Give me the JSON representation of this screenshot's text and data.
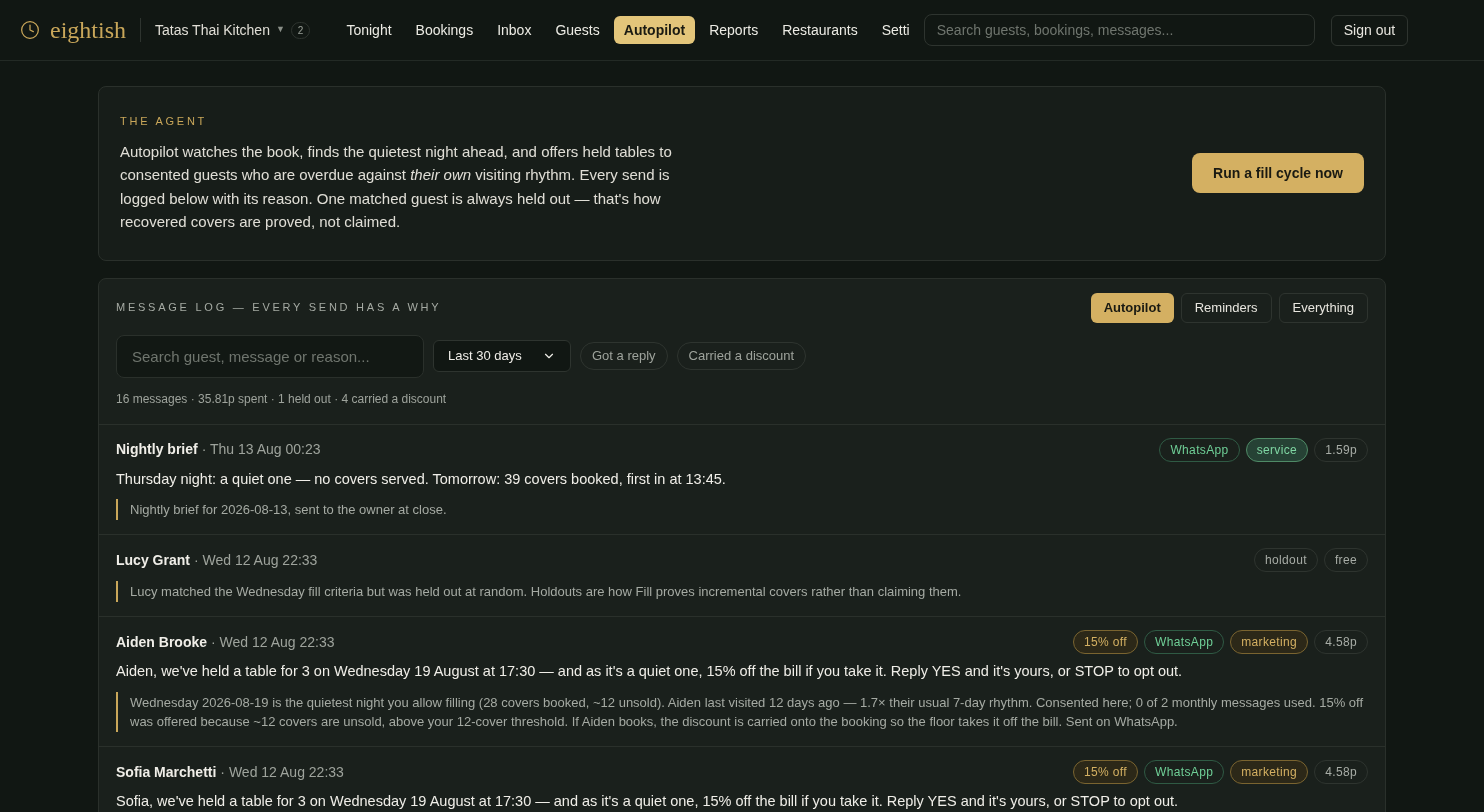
{
  "header": {
    "logo": "eightish",
    "restaurant": "Tatas Thai Kitchen",
    "caret": "▼",
    "restaurant_count": "2",
    "nav": [
      {
        "label": "Tonight",
        "selected": false
      },
      {
        "label": "Bookings",
        "selected": false
      },
      {
        "label": "Inbox",
        "selected": false
      },
      {
        "label": "Guests",
        "selected": false
      },
      {
        "label": "Autopilot",
        "selected": true
      },
      {
        "label": "Reports",
        "selected": false
      },
      {
        "label": "Restaurants",
        "selected": false
      },
      {
        "label": "Setti",
        "selected": false
      }
    ],
    "search": {
      "placeholder": "Search guests, bookings, messages..."
    },
    "sign_out": "Sign out"
  },
  "agent": {
    "eyebrow": "THE AGENT",
    "description": "Autopilot watches the book, finds the quietest night ahead, and offers held tables to consented guests who are overdue against *their own* visiting rhythm. Every send is logged below with its reason. One matched guest is always held out — that's how recovered covers are proved, not claimed.",
    "button": "Run a fill cycle now"
  },
  "log": {
    "title": "MESSAGE LOG — EVERY SEND HAS A WHY",
    "tabs": [
      {
        "label": "Autopilot",
        "selected": true
      },
      {
        "label": "Reminders",
        "selected": false
      },
      {
        "label": "Everything",
        "selected": false
      }
    ],
    "search": {
      "placeholder": "Search guest, message or reason..."
    },
    "period": "Last 30 days",
    "chips": [
      {
        "label": "Got a reply",
        "selected": false
      },
      {
        "label": "Carried a discount",
        "selected": false
      }
    ],
    "summary": "16 messages · 35.81p spent · 1 held out · 4 carried a discount",
    "messages": [
      {
        "name": "Nightly brief",
        "date": "· Thu 13 Aug 00:23",
        "tags": [
          {
            "label": "WhatsApp",
            "kind": "channel"
          },
          {
            "label": "service",
            "kind": "service"
          },
          {
            "label": "1.59p",
            "kind": "plain"
          }
        ],
        "text": "Thursday night: a quiet one — no covers served. Tomorrow: 39 covers booked, first in at 13:45.",
        "reason": "Nightly brief for 2026-08-13, sent to the owner at close."
      },
      {
        "name": "Lucy Grant",
        "date": "· Wed 12 Aug 22:33",
        "tags": [
          {
            "label": "holdout",
            "kind": "plain"
          },
          {
            "label": "free",
            "kind": "plain"
          }
        ],
        "reason": "Lucy matched the Wednesday fill criteria but was held out at random. Holdouts are how Fill proves incremental covers rather than claiming them."
      },
      {
        "name": "Aiden Brooke",
        "date": "· Wed 12 Aug 22:33",
        "tags": [
          {
            "label": "15% off",
            "kind": "offer"
          },
          {
            "label": "WhatsApp",
            "kind": "channel"
          },
          {
            "label": "marketing",
            "kind": "offer"
          },
          {
            "label": "4.58p",
            "kind": "plain"
          }
        ],
        "text": "Aiden, we've held a table for 3 on Wednesday 19 August at 17:30 — and as it's a quiet one, 15% off the bill if you take it. Reply YES and it's yours, or STOP to opt out.",
        "reason": "Wednesday 2026-08-19 is the quietest night you allow filling (28 covers booked, ~12 unsold). Aiden last visited 12 days ago — 1.7× their usual 7-day rhythm. Consented here; 0 of 2 monthly messages used. 15% off was offered because ~12 covers are unsold, above your 12-cover threshold. If Aiden books, the discount is carried onto the booking so the floor takes it off the bill. Sent on WhatsApp."
      },
      {
        "name": "Sofia Marchetti",
        "date": "· Wed 12 Aug 22:33",
        "tags": [
          {
            "label": "15% off",
            "kind": "offer"
          },
          {
            "label": "WhatsApp",
            "kind": "channel"
          },
          {
            "label": "marketing",
            "kind": "offer"
          },
          {
            "label": "4.58p",
            "kind": "plain"
          }
        ],
        "text": "Sofia, we've held a table for 3 on Wednesday 19 August at 17:30 — and as it's a quiet one, 15% off the bill if you take it. Reply YES and it's yours, or STOP to opt out."
      }
    ]
  }
}
